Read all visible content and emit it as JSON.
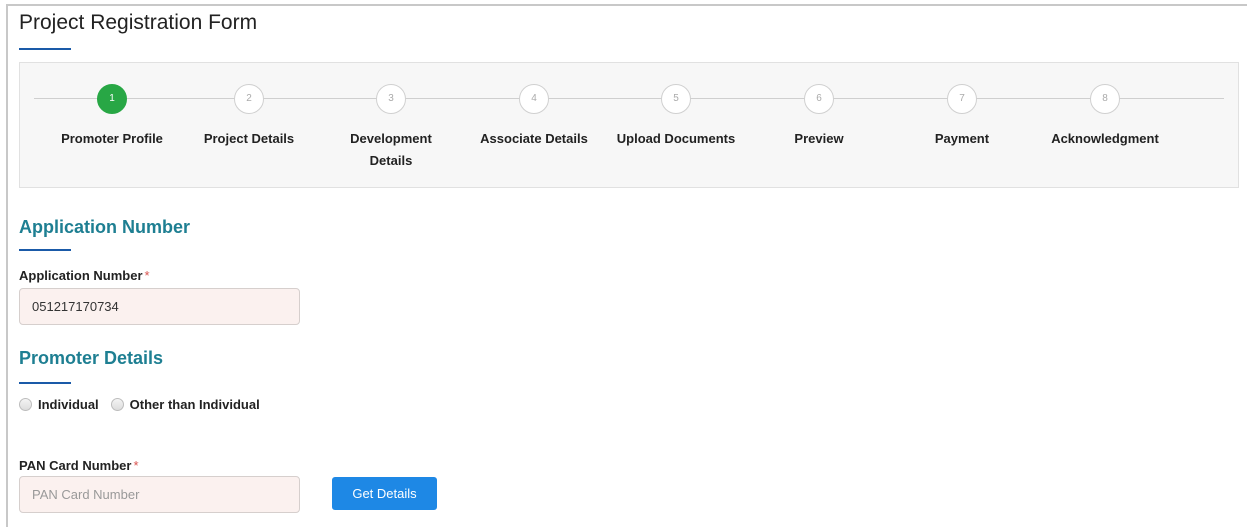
{
  "page": {
    "title": "Project Registration Form"
  },
  "stepper": {
    "steps": [
      {
        "number": "1",
        "label": "Promoter Profile",
        "active": true
      },
      {
        "number": "2",
        "label": "Project Details",
        "active": false
      },
      {
        "number": "3",
        "label": "Development Details",
        "active": false
      },
      {
        "number": "4",
        "label": "Associate Details",
        "active": false
      },
      {
        "number": "5",
        "label": "Upload Documents",
        "active": false
      },
      {
        "number": "6",
        "label": "Preview",
        "active": false
      },
      {
        "number": "7",
        "label": "Payment",
        "active": false
      },
      {
        "number": "8",
        "label": "Acknowledgment",
        "active": false
      }
    ]
  },
  "application": {
    "section_title": "Application Number",
    "field_label": "Application Number",
    "required_mark": "*",
    "value": "051217170734"
  },
  "promoter": {
    "section_title": "Promoter Details",
    "options": [
      "Individual",
      "Other than Individual"
    ]
  },
  "pan": {
    "field_label": "PAN Card Number",
    "required_mark": "*",
    "value": "",
    "placeholder": "PAN Card Number",
    "button_label": "Get Details"
  },
  "colors": {
    "accent": "#1e88e5",
    "section_title": "#1e7f92",
    "active_step": "#28a745",
    "required": "#d9534f"
  }
}
